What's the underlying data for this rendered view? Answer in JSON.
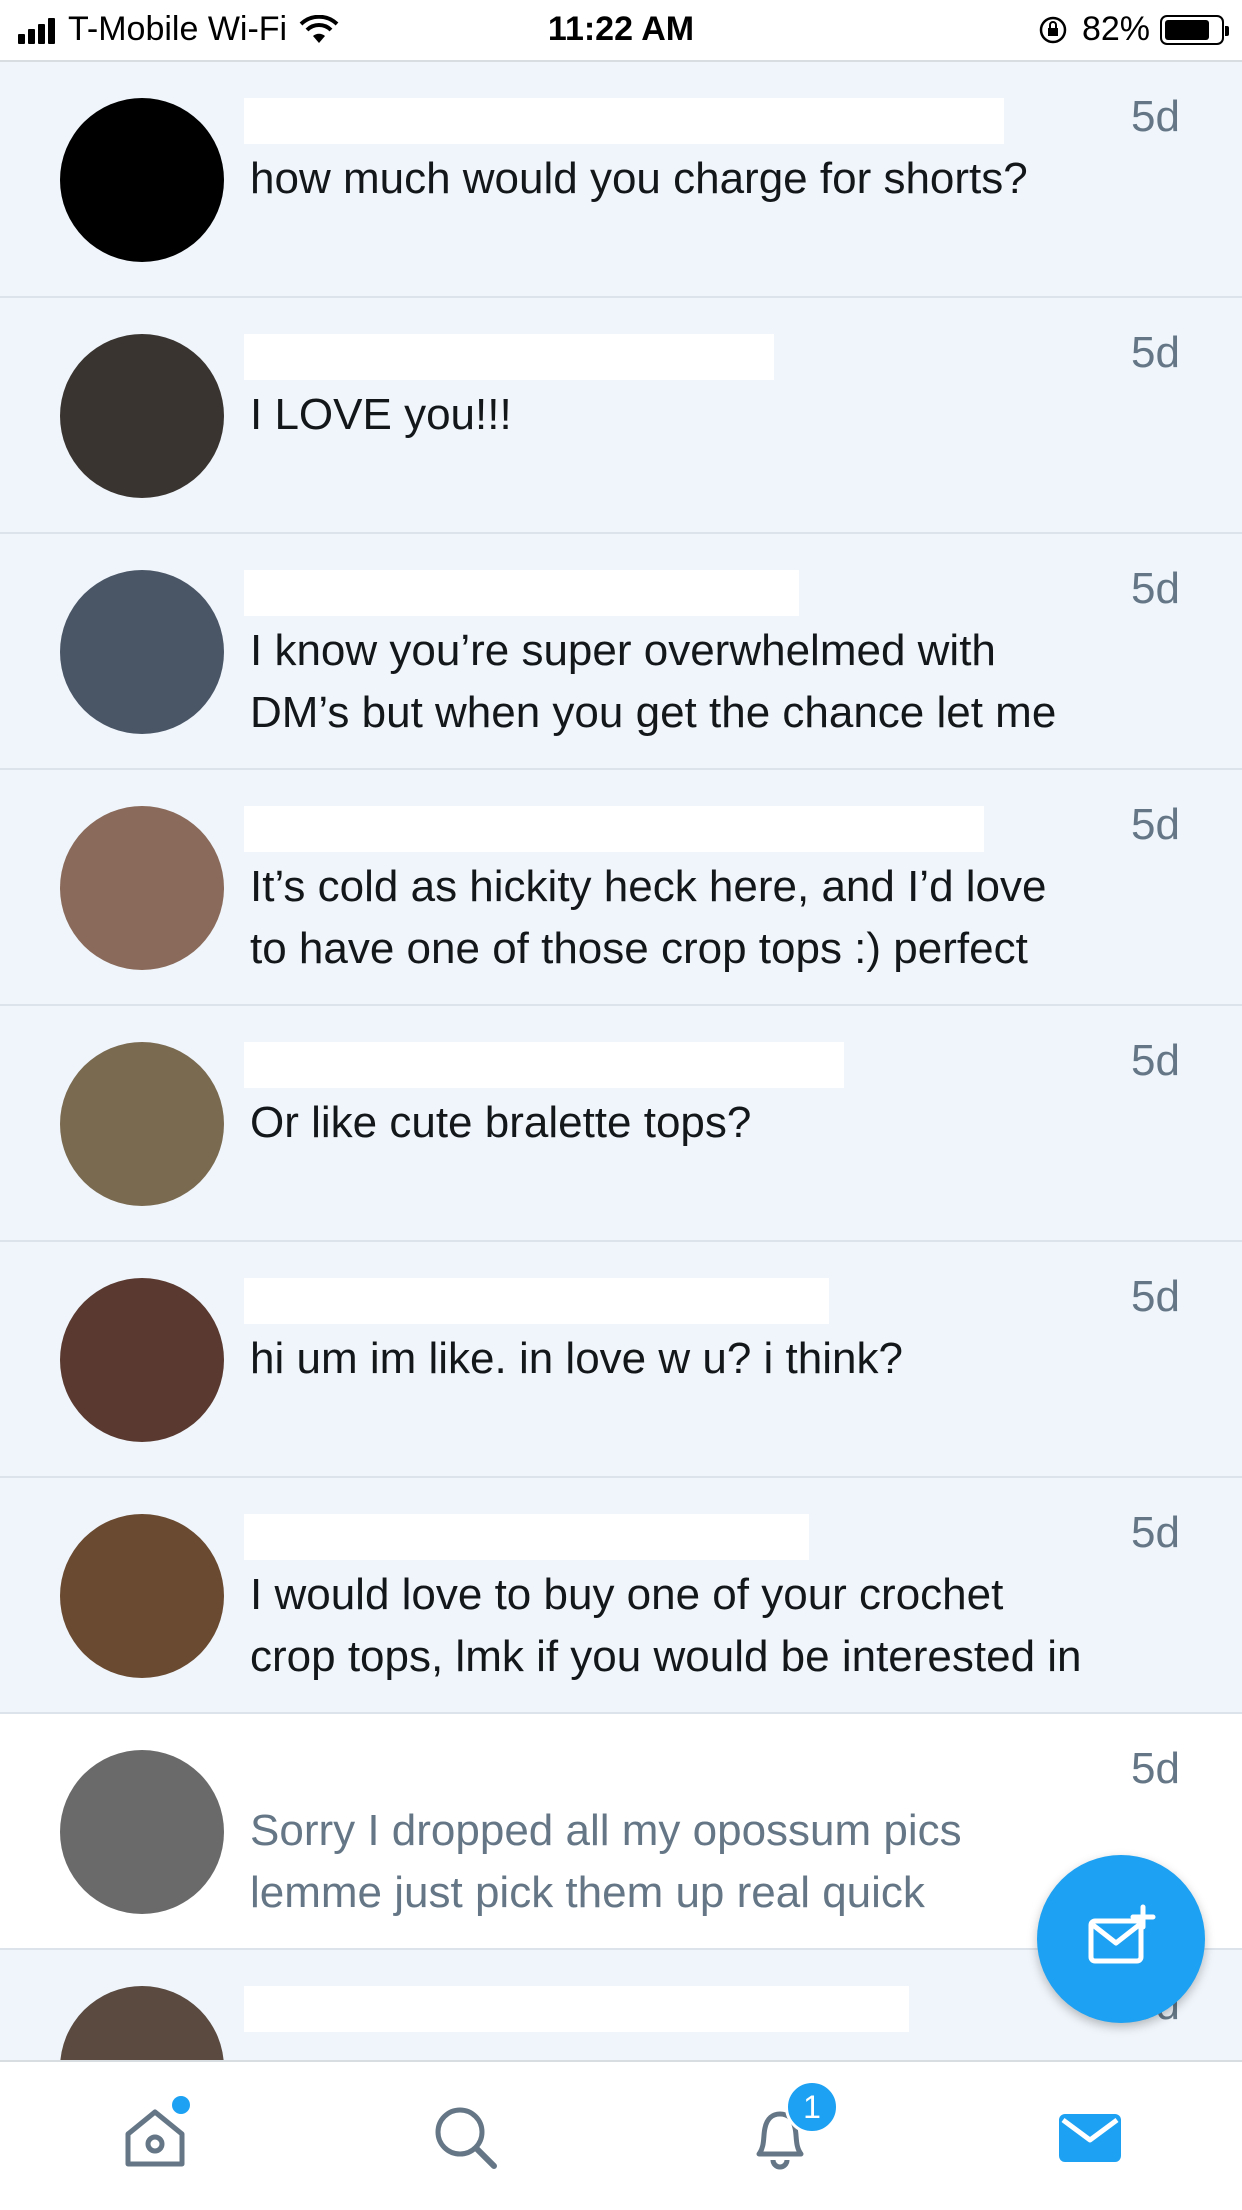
{
  "status_bar": {
    "carrier": "T-Mobile Wi-Fi",
    "time": "11:22 AM",
    "battery": "82%",
    "battery_level": 0.82
  },
  "conversations": [
    {
      "time": "5d",
      "message": "how much would you charge for shorts?",
      "read": false,
      "avatar_color": "#000000"
    },
    {
      "time": "5d",
      "message": "I LOVE you!!!",
      "read": false,
      "avatar_color": "#3a3430"
    },
    {
      "time": "5d",
      "message": "I know you’re super overwhelmed with\nDM’s but when you get the chance let me",
      "read": false,
      "avatar_color": "#4a5566"
    },
    {
      "time": "5d",
      "message": "It’s cold as hickity heck here, and I’d love\nto have one of those crop tops :) perfect",
      "read": false,
      "avatar_color": "#8a6a5a"
    },
    {
      "time": "5d",
      "message": "Or like cute bralette tops?",
      "read": false,
      "avatar_color": "#7a6a50"
    },
    {
      "time": "5d",
      "message": "hi um im like. in love w u? i think?",
      "read": false,
      "avatar_color": "#5a3a30"
    },
    {
      "time": "5d",
      "message": "I would love to buy one of your crochet\ncrop tops, lmk if you would be interested in",
      "read": false,
      "avatar_color": "#6a4a30"
    },
    {
      "time": "5d",
      "message": "Sorry I dropped all my opossum pics\nlemme just pick them up real quick",
      "read": true,
      "avatar_color": "#6a6a6a"
    },
    {
      "time": "5d",
      "message": "",
      "read": false,
      "avatar_color": "#5a4a40"
    }
  ],
  "fab": {
    "icon": "compose-message-icon"
  },
  "tab_bar": {
    "tabs": [
      {
        "icon": "home-icon",
        "active": false
      },
      {
        "icon": "search-icon",
        "active": false
      },
      {
        "icon": "notifications-icon",
        "active": false,
        "badge": "1"
      },
      {
        "icon": "messages-icon",
        "active": true
      }
    ]
  },
  "colors": {
    "accent": "#1da1f2",
    "unread_bg": "#eff5fb",
    "secondary_text": "#657786"
  }
}
